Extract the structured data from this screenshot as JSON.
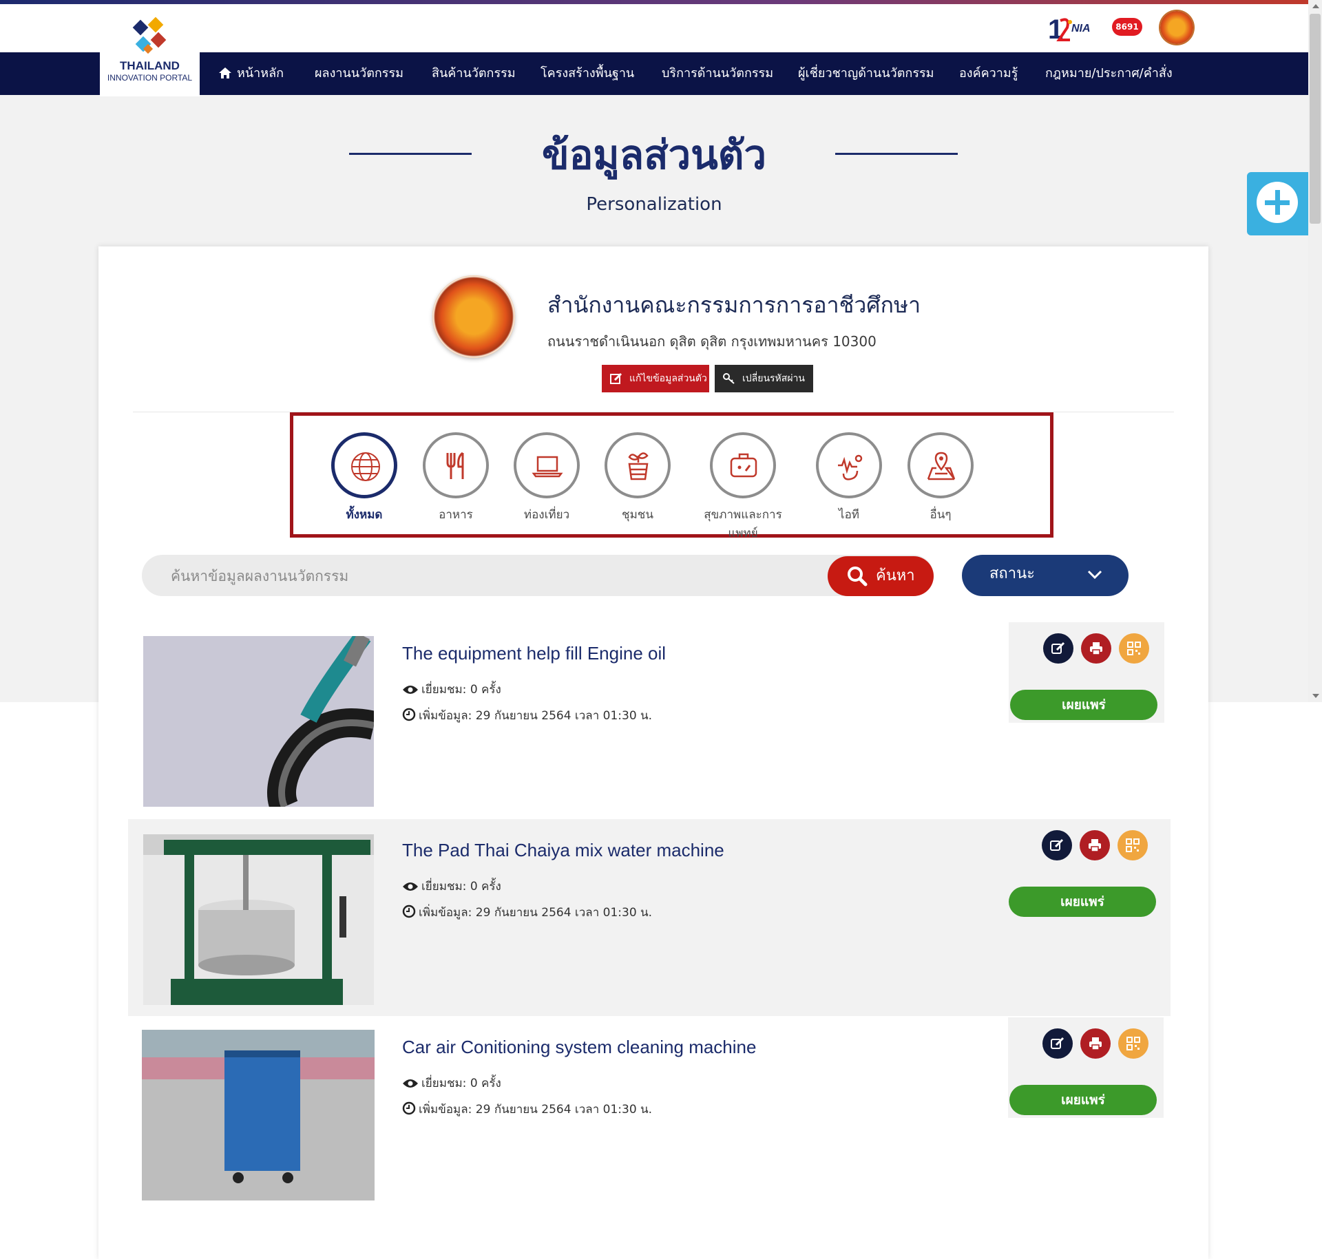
{
  "brand": {
    "name_line1": "THAILAND",
    "name_line2": "INNOVATION PORTAL"
  },
  "top_logos": {
    "hotline": "8691"
  },
  "nav": {
    "items": [
      "หน้าหลัก",
      "ผลงานนวัตกรรม",
      "สินค้านวัตกรรม",
      "โครงสร้างพื้นฐาน",
      "บริการด้านนวัตกรรม",
      "ผู้เชี่ยวชาญด้านนวัตกรรม",
      "องค์ความรู้",
      "กฎหมาย/ประกาศ/คำสั่ง"
    ]
  },
  "page": {
    "title": "ข้อมูลส่วนตัว",
    "subtitle": "Personalization"
  },
  "profile": {
    "name": "สำนักงานคณะกรรมการการอาชีวศึกษา",
    "address": "ถนนราชดำเนินนอก ดุสิต ดุสิต กรุงเทพมหานคร 10300",
    "edit_label": "แก้ไขข้อมูลส่วนตัว",
    "password_label": "เปลี่ยนรหัสผ่าน"
  },
  "categories": [
    "ทั้งหมด",
    "อาหาร",
    "ท่องเที่ยว",
    "ชุมชน",
    "สุขภาพและการแพทย์",
    "ไอที",
    "อื่นๆ"
  ],
  "search": {
    "placeholder": "ค้นหาข้อมูลผลงานนวัตกรรม",
    "button_label": "ค้นหา"
  },
  "status_filter": {
    "label": "สถานะ"
  },
  "items": [
    {
      "title": "The equipment help fill Engine oil",
      "views": "เยี่ยมชม: 0 ครั้ง",
      "added": "เพิ่มข้อมูล: 29 กันยายน 2564 เวลา 01:30 น.",
      "publish_label": "เผยแพร่"
    },
    {
      "title": "The Pad Thai Chaiya mix water machine",
      "views": "เยี่ยมชม: 0 ครั้ง",
      "added": "เพิ่มข้อมูล: 29 กันยายน 2564 เวลา 01:30 น.",
      "publish_label": "เผยแพร่"
    },
    {
      "title": "Car air Conitioning system cleaning machine",
      "views": "เยี่ยมชม: 0 ครั้ง",
      "added": "เพิ่มข้อมูล: 29 กันยายน 2564 เวลา 01:30 น.",
      "publish_label": "เผยแพร่"
    }
  ],
  "colors": {
    "navy": "#0b1346",
    "accent_red": "#c71a12",
    "highlight_border": "#a01419",
    "publish_green": "#3c9a2a",
    "status_blue": "#1b3a78",
    "plus_blue": "#3ab0e0"
  }
}
